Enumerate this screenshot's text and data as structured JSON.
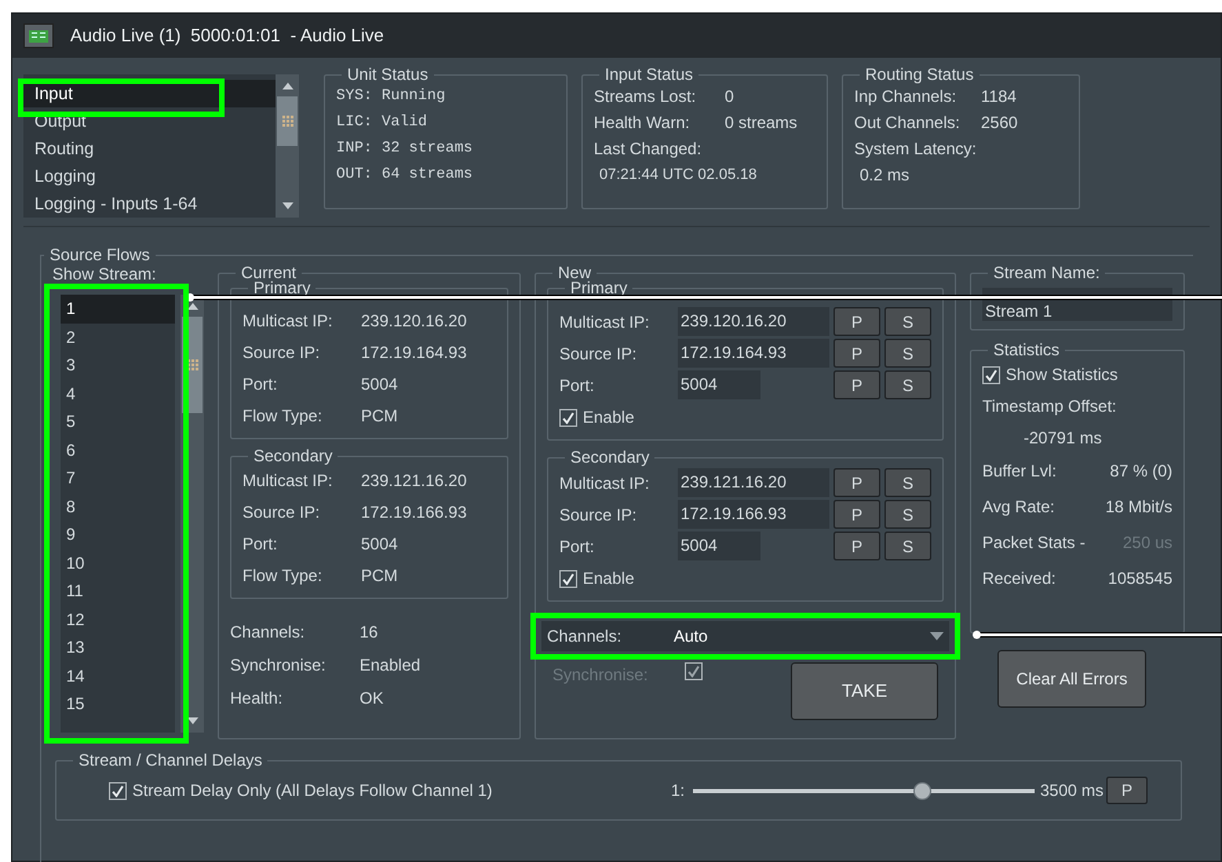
{
  "window": {
    "title": "Audio Live (1)  5000:01:01  - Audio Live"
  },
  "nav_list": [
    {
      "label": "Input",
      "selected": true
    },
    {
      "label": "Output",
      "selected": false
    },
    {
      "label": "Routing",
      "selected": false
    },
    {
      "label": "Logging",
      "selected": false
    },
    {
      "label": "Logging - Inputs 1-64",
      "selected": false
    }
  ],
  "unit_status": {
    "title": "Unit Status",
    "lines": [
      "SYS: Running",
      "LIC: Valid",
      "INP: 32 streams",
      "OUT: 64 streams"
    ]
  },
  "input_status": {
    "title": "Input Status",
    "rows": [
      {
        "label": "Streams Lost:",
        "value": "0"
      },
      {
        "label": "Health Warn:",
        "value": "0 streams"
      },
      {
        "label": "Last Changed:",
        "value": ""
      }
    ],
    "last_changed_value": "07:21:44 UTC 02.05.18"
  },
  "routing_status": {
    "title": "Routing Status",
    "rows": [
      {
        "label": "Inp Channels:",
        "value": "1184"
      },
      {
        "label": "Out Channels:",
        "value": "2560"
      },
      {
        "label": "System Latency:",
        "value": ""
      }
    ],
    "latency_value": "0.2 ms"
  },
  "source_flows": {
    "title": "Source Flows",
    "show_stream_label": "Show Stream:",
    "streams": [
      {
        "label": "1",
        "selected": true
      },
      {
        "label": "2",
        "selected": false
      },
      {
        "label": "3",
        "selected": false
      },
      {
        "label": "4",
        "selected": false
      },
      {
        "label": "5",
        "selected": false
      },
      {
        "label": "6",
        "selected": false
      },
      {
        "label": "7",
        "selected": false
      },
      {
        "label": "8",
        "selected": false
      },
      {
        "label": "9",
        "selected": false
      },
      {
        "label": "10",
        "selected": false
      },
      {
        "label": "11",
        "selected": false
      },
      {
        "label": "12",
        "selected": false
      },
      {
        "label": "13",
        "selected": false
      },
      {
        "label": "14",
        "selected": false
      },
      {
        "label": "15",
        "selected": false
      }
    ],
    "current": {
      "title": "Current",
      "groups": [
        {
          "title": "Primary",
          "rows": [
            {
              "label": "Multicast IP:",
              "value": "239.120.16.20"
            },
            {
              "label": "Source IP:",
              "value": "172.19.164.93"
            },
            {
              "label": "Port:",
              "value": "5004"
            },
            {
              "label": "Flow Type:",
              "value": "PCM"
            }
          ]
        },
        {
          "title": "Secondary",
          "rows": [
            {
              "label": "Multicast IP:",
              "value": "239.121.16.20"
            },
            {
              "label": "Source IP:",
              "value": "172.19.166.93"
            },
            {
              "label": "Port:",
              "value": "5004"
            },
            {
              "label": "Flow Type:",
              "value": "PCM"
            }
          ]
        }
      ],
      "rows": [
        {
          "label": "Channels:",
          "value": "16"
        },
        {
          "label": "Synchronise:",
          "value": "Enabled"
        },
        {
          "label": "Health:",
          "value": "OK"
        }
      ]
    },
    "new": {
      "title": "New",
      "groups": [
        {
          "title": "Primary",
          "rows": [
            {
              "label": "Multicast IP:",
              "value": "239.120.16.20",
              "buttons": [
                "P",
                "S"
              ]
            },
            {
              "label": "Source IP:",
              "value": "172.19.164.93",
              "buttons": [
                "P",
                "S"
              ]
            },
            {
              "label": "Port:",
              "value": "5004",
              "buttons": [
                "P",
                "S"
              ]
            }
          ],
          "enable": {
            "label": "Enable",
            "checked": true
          }
        },
        {
          "title": "Secondary",
          "rows": [
            {
              "label": "Multicast IP:",
              "value": "239.121.16.20",
              "buttons": [
                "P",
                "S"
              ]
            },
            {
              "label": "Source IP:",
              "value": "172.19.166.93",
              "buttons": [
                "P",
                "S"
              ]
            },
            {
              "label": "Port:",
              "value": "5004",
              "buttons": [
                "P",
                "S"
              ]
            }
          ],
          "enable": {
            "label": "Enable",
            "checked": true
          }
        }
      ],
      "channels": {
        "label": "Channels:",
        "value": "Auto"
      },
      "synchronise": {
        "label": "Synchronise:",
        "checked": true,
        "disabled": true
      },
      "take_button": "TAKE"
    },
    "stream_name": {
      "title": "Stream Name:",
      "value": "Stream 1"
    },
    "statistics": {
      "title": "Statistics",
      "show_statistics": {
        "label": "Show Statistics",
        "checked": true
      },
      "rows": [
        {
          "kind": "stacked",
          "label": "Timestamp Offset:",
          "value": "-20791 ms",
          "disabled": false
        },
        {
          "kind": "pair",
          "label": "Buffer Lvl:",
          "value": "87 % (0)",
          "disabled": false
        },
        {
          "kind": "pair",
          "label": "Avg Rate:",
          "value": "18 Mbit/s",
          "disabled": false
        },
        {
          "kind": "pair",
          "label": "Packet Stats -",
          "value": "250 us",
          "disabled": true
        },
        {
          "kind": "pair",
          "label": "Received:",
          "value": "1058545",
          "disabled": false
        }
      ]
    },
    "clear_button": "Clear All Errors"
  },
  "delays": {
    "title": "Stream / Channel Delays",
    "checkbox": {
      "label": "Stream Delay Only (All Delays Follow Channel 1)",
      "checked": true
    },
    "slider": {
      "label": "1:",
      "level": 0.67,
      "reading": "3500 ms"
    },
    "button": "P"
  }
}
